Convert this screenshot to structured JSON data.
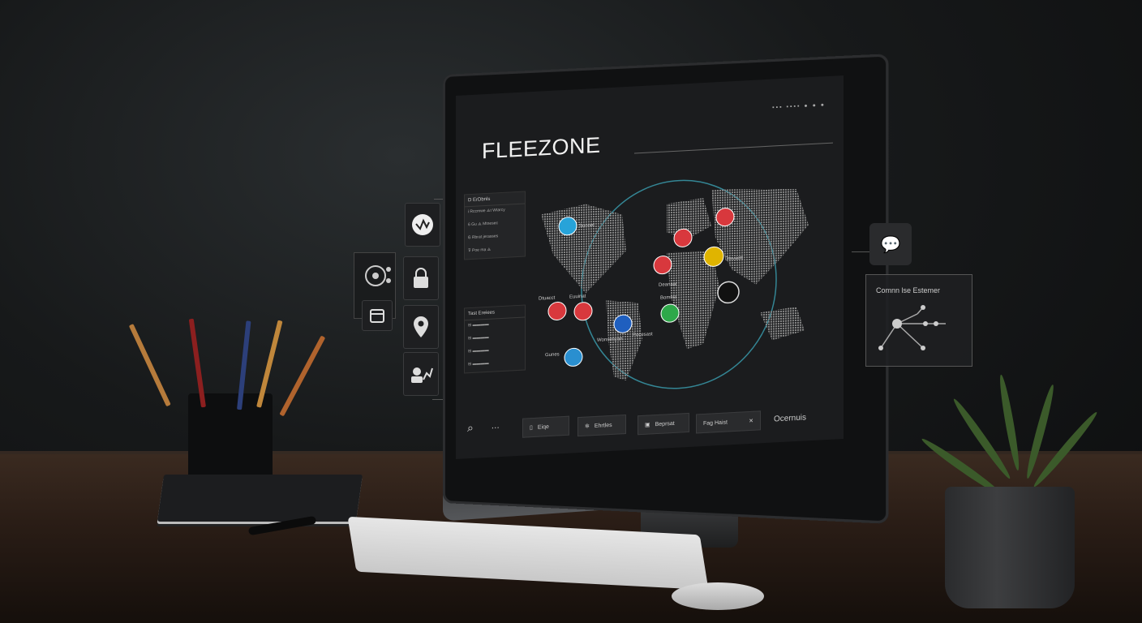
{
  "app": {
    "title": "FLEEZONE",
    "header_indicators": "▪▪▪ ▪▪▪▪ ● ● ●"
  },
  "left_panels": [
    {
      "heading": "D ErDbnls",
      "rows": [
        "Ꭵ Rccmwe ⟁t Wtarcy",
        "6 Gu ⟁ Mtnesec",
        "Ꮆ Rbrat jerasses",
        "⊽ Poe ma ⟁"
      ]
    },
    {
      "heading": "Tast Ereiees",
      "rows": [
        "⊟ ▬▬▬▬",
        "⊟ ▬▬▬▬",
        "⊟ ▬▬▬▬",
        "⊟ ▬▬▬▬"
      ]
    }
  ],
  "map": {
    "labels": [
      {
        "text": "Sunnel",
        "icon": "ring-icon",
        "color": "#27a3d9"
      },
      {
        "text": "Dtuacct",
        "icon": "fingerprint-icon",
        "color": "#d8383d"
      },
      {
        "text": "Euuinat",
        "icon": "lock-icon",
        "color": "#d8383d"
      },
      {
        "text": "Pocesast",
        "icon": "lock-icon",
        "color": "#1f5fbf"
      },
      {
        "text": "Gunes",
        "icon": "pin-icon",
        "color": "#2a8fd0"
      },
      {
        "text": "Wonsenyan",
        "icon": "shield-icon",
        "color": "#2ea84a"
      },
      {
        "text": "Deanaat",
        "icon": "pin-icon",
        "color": "#d8383d"
      },
      {
        "text": "Bomnia",
        "icon": "sync-icon",
        "color": "#e0b400"
      },
      {
        "text": "Dtsvaett",
        "icon": "lock-icon",
        "color": "#ffffff"
      },
      {
        "text": "",
        "icon": "face-icon",
        "color": "#d8383d"
      },
      {
        "text": "",
        "icon": "bag-icon",
        "color": "#d8383d"
      }
    ]
  },
  "toolbar": {
    "search_label": "⋯",
    "buttons": [
      {
        "label": "Eiqe",
        "icon": "doc-icon"
      },
      {
        "label": "Ehrtles",
        "icon": "gear-icon"
      },
      {
        "label": "Beprsat",
        "icon": "image-icon"
      },
      {
        "label": "Fag Haist",
        "icon": "list-icon"
      }
    ],
    "right_label": "Ocernuis"
  },
  "side_tiles": [
    "activity-icon",
    "lock-icon",
    "location-pin-icon",
    "chart-icon"
  ],
  "left_widget": {
    "icons": [
      "target-icon",
      "calendar-icon"
    ]
  },
  "right_card": {
    "title": "Comnn lse Estemer"
  },
  "chat_icon": "chat-bubble-icon"
}
